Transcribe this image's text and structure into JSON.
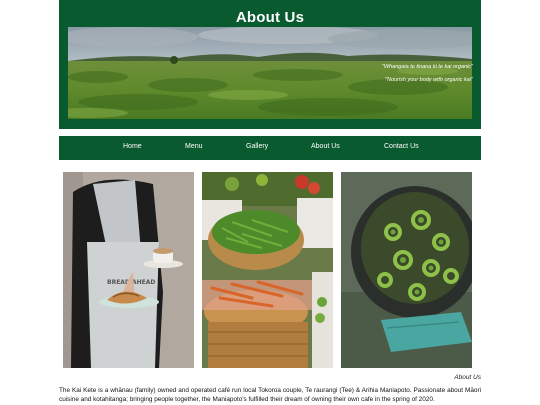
{
  "header": {
    "title": "About Us",
    "quote_line1": "\"Whangaia te tinana ki te kai organic\"",
    "quote_line2": "\"Nourish your body with organic kai\""
  },
  "nav": {
    "items": [
      {
        "label": "Home"
      },
      {
        "label": "Menu"
      },
      {
        "label": "Gallery"
      },
      {
        "label": "About Us"
      },
      {
        "label": "Contact Us"
      }
    ]
  },
  "gallery": {
    "photo1": {
      "apron_text": "BREAD AHEAD"
    }
  },
  "content": {
    "caption": "About Us",
    "paragraph": "The Kai Kete is a whānau (family) owned and operated café run local Tokoroa couple, Te raurangi (Tee) & Arihia Maniapoto. Passionate about Māori cuisine and kotahitanga; bringing people together, the Maniapoto's fulfilled their dream of owning their own cafe in the spring of 2020."
  },
  "colors": {
    "brand_green": "#0a5a2f"
  }
}
